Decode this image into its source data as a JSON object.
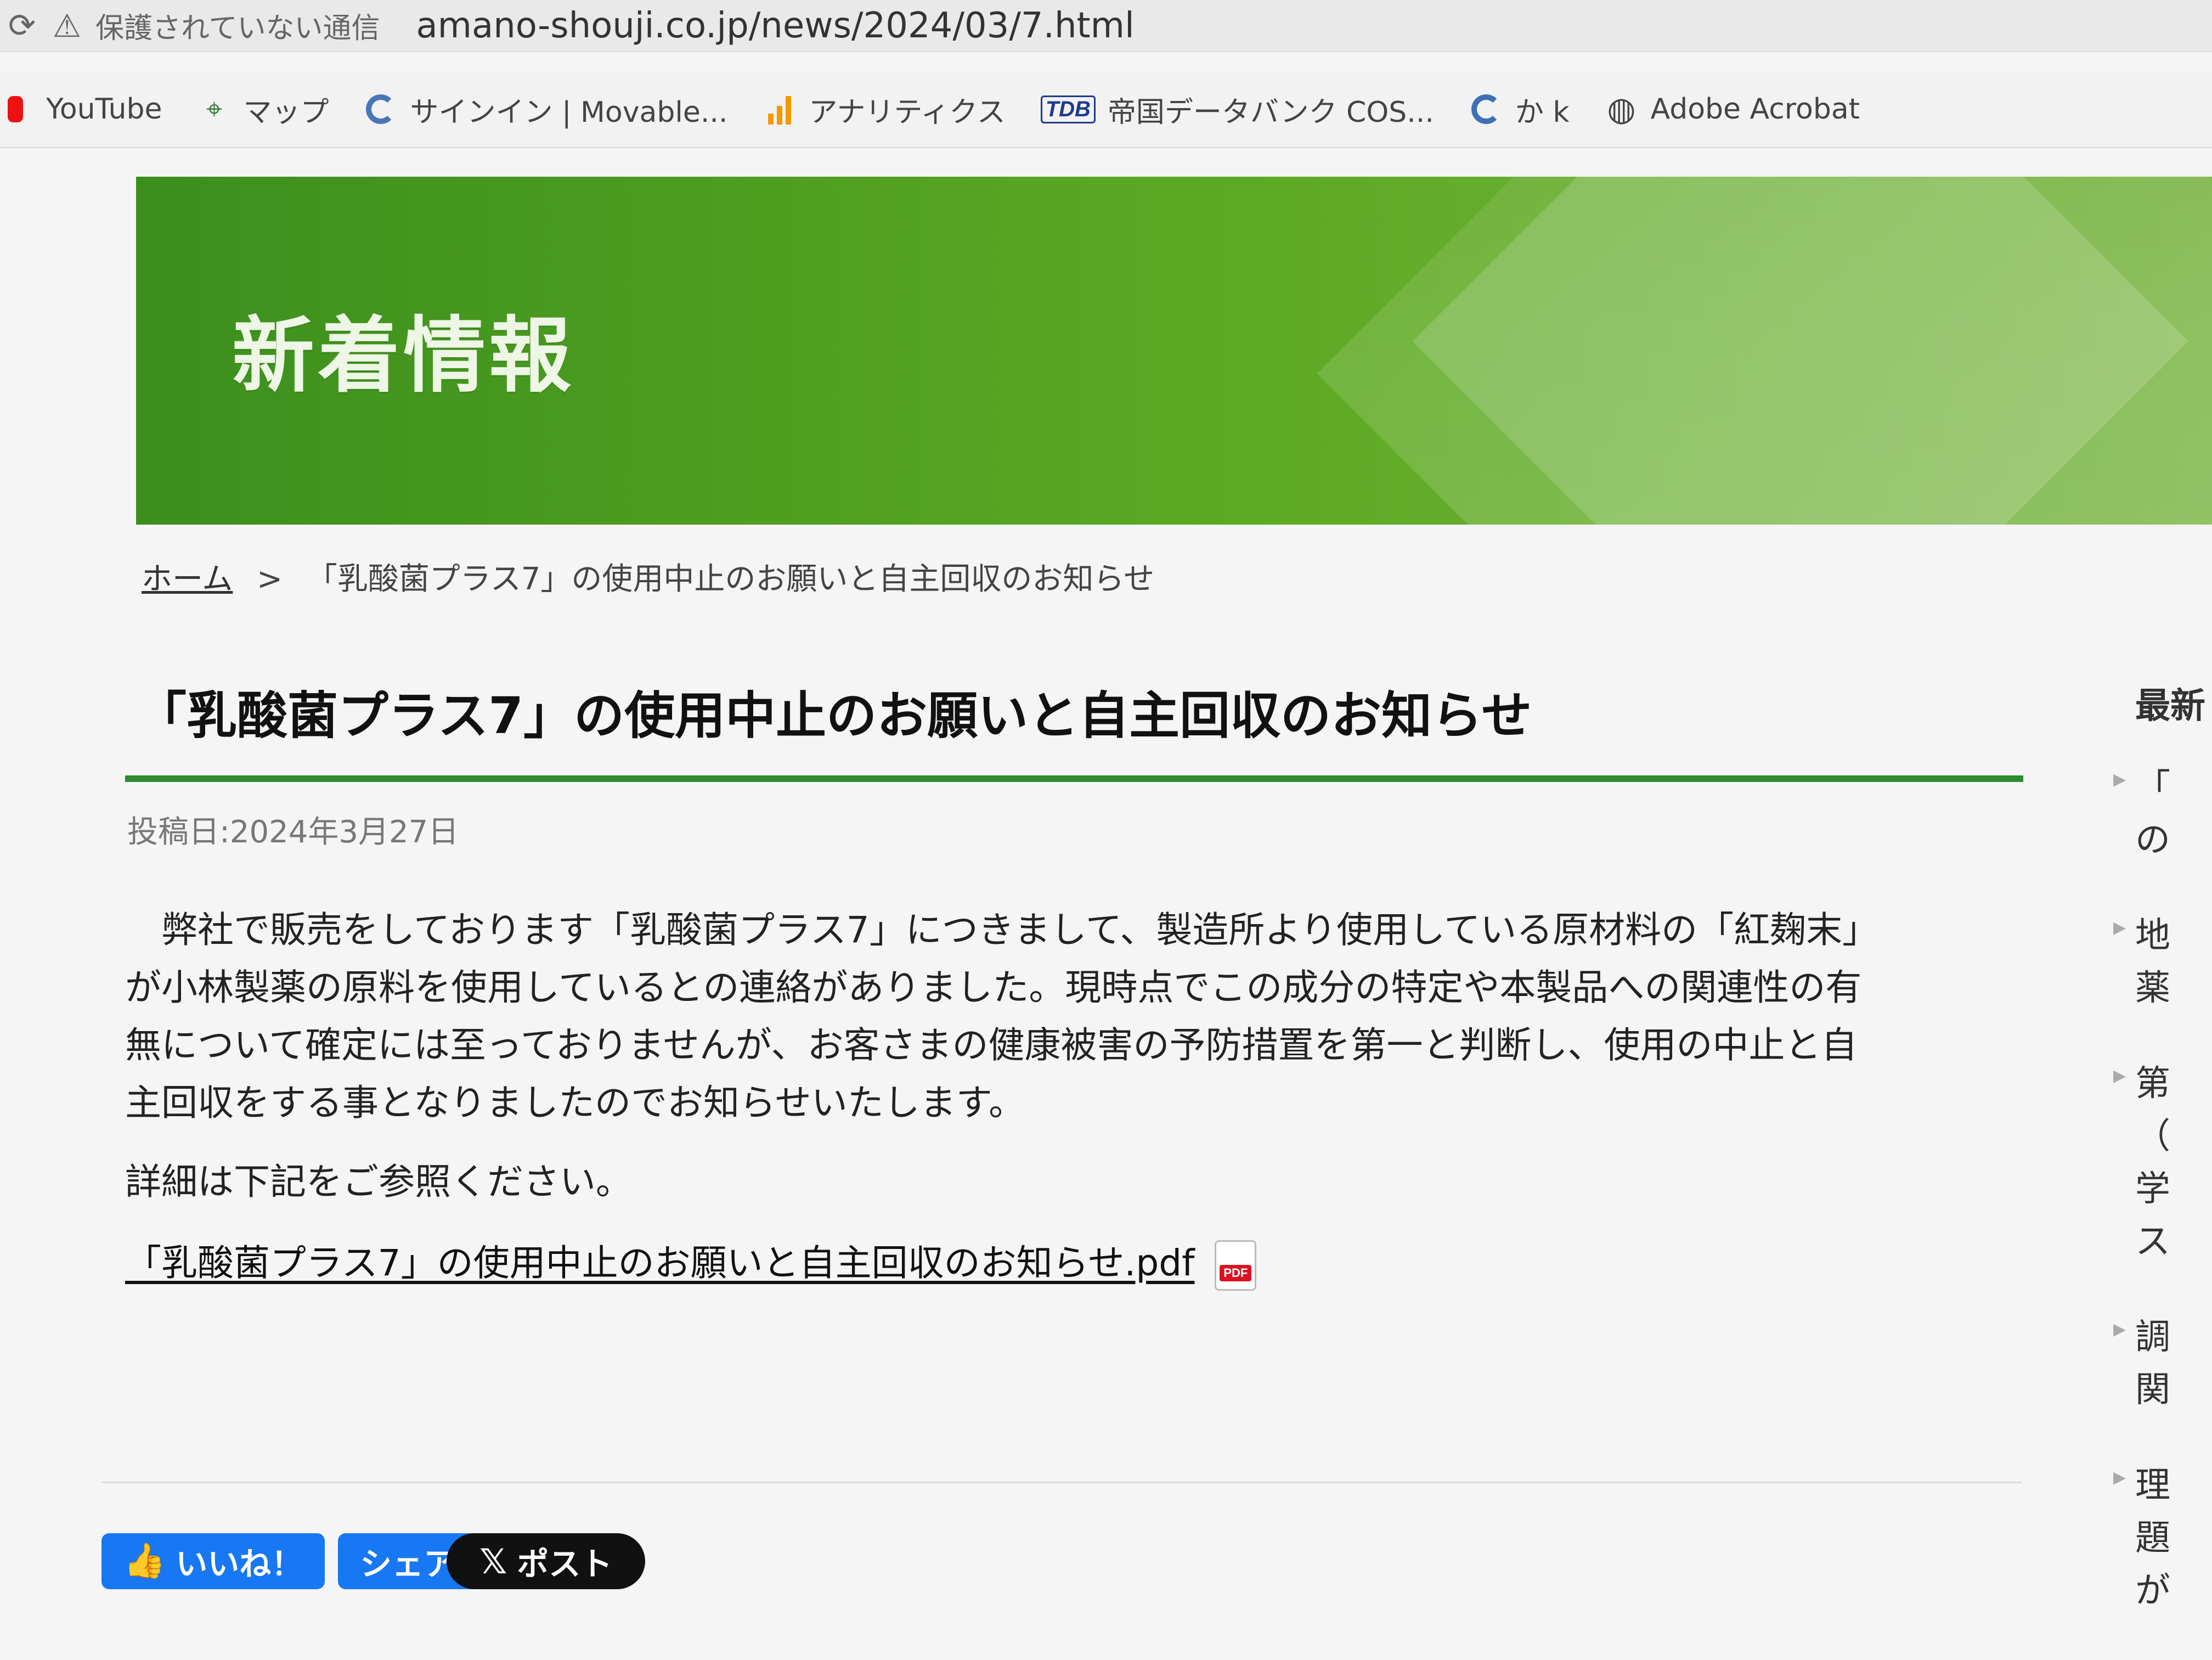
{
  "browser": {
    "warning_text": "保護されていない通信",
    "url": "amano-shouji.co.jp/news/2024/03/7.html"
  },
  "bookmarks": [
    {
      "label": "YouTube",
      "icon": "youtube-icon"
    },
    {
      "label": "マップ",
      "icon": "maps-icon"
    },
    {
      "label": "サインイン | Movable...",
      "icon": "movabletype-icon"
    },
    {
      "label": "アナリティクス",
      "icon": "analytics-icon"
    },
    {
      "label": "帝国データバンク COS...",
      "icon": "tdb-icon"
    },
    {
      "label": "か k",
      "icon": "loading-icon"
    },
    {
      "label": "Adobe Acrobat",
      "icon": "globe-icon"
    }
  ],
  "header": {
    "title": "新着情報"
  },
  "breadcrumb": {
    "home": "ホーム",
    "separator": ">",
    "current": "「乳酸菌プラス7」の使用中止のお願いと自主回収のお知らせ"
  },
  "article": {
    "title": "「乳酸菌プラス7」の使用中止のお願いと自主回収のお知らせ",
    "posted": "投稿日:2024年3月27日",
    "body_lines": [
      "　弊社で販売をしております「乳酸菌プラス7」につきまして、製造所より使用している原材料の「紅麹末」",
      "が小林製薬の原料を使用しているとの連絡がありました。現時点でこの成分の特定や本製品への関連性の有",
      "無について確定には至っておりませんが、お客さまの健康被害の予防措置を第一と判断し、使用の中止と自",
      "主回収をする事となりましたのでお知らせいたします。"
    ],
    "detail_text": "詳細は下記をご参照ください。",
    "pdf_link_text": "「乳酸菌プラス7」の使用中止のお願いと自主回収のお知らせ.pdf",
    "pdf_badge": "PDF"
  },
  "social": {
    "like": "いいね！",
    "share": "シェア",
    "post": "ポスト"
  },
  "sidebar": {
    "heading": "最新",
    "items": [
      [
        "「",
        "の"
      ],
      [
        "地",
        "薬"
      ],
      [
        "第",
        "（",
        "学",
        "ス"
      ],
      [
        "調",
        "関"
      ],
      [
        "理",
        "題",
        "が"
      ]
    ]
  },
  "colors": {
    "green": "#2e8a2e",
    "facebook_blue": "#1877f2"
  }
}
